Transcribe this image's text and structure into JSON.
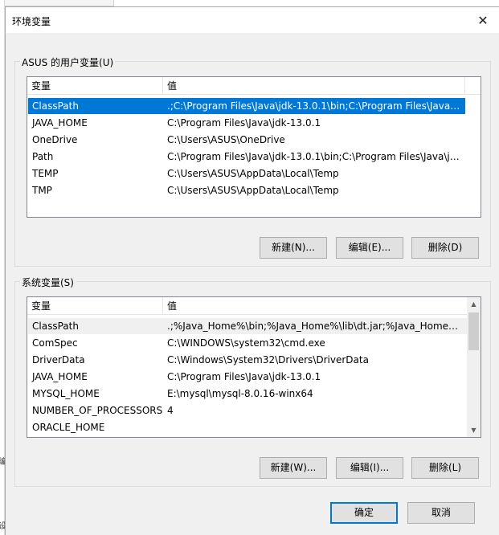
{
  "window": {
    "title": "环境变量"
  },
  "user_vars": {
    "group_label": "ASUS 的用户变量(U)",
    "col_name": "变量",
    "col_value": "值",
    "rows": [
      {
        "name": "ClassPath",
        "value": ".;C:\\Program Files\\Java\\jdk-13.0.1\\bin;C:\\Program Files\\Java\\j...",
        "selected": true
      },
      {
        "name": "JAVA_HOME",
        "value": "C:\\Program Files\\Java\\jdk-13.0.1"
      },
      {
        "name": "OneDrive",
        "value": "C:\\Users\\ASUS\\OneDrive"
      },
      {
        "name": "Path",
        "value": "C:\\Program Files\\Java\\jdk-13.0.1\\bin;C:\\Program Files\\Java\\jd..."
      },
      {
        "name": "TEMP",
        "value": "C:\\Users\\ASUS\\AppData\\Local\\Temp"
      },
      {
        "name": "TMP",
        "value": "C:\\Users\\ASUS\\AppData\\Local\\Temp"
      }
    ],
    "buttons": {
      "new": "新建(N)...",
      "edit": "编辑(E)...",
      "delete": "删除(D)"
    }
  },
  "sys_vars": {
    "group_label": "系统变量(S)",
    "col_name": "变量",
    "col_value": "值",
    "rows": [
      {
        "name": "ClassPath",
        "value": ".;%Java_Home%\\bin;%Java_Home%\\lib\\dt.jar;%Java_Home%\\...",
        "hot": true
      },
      {
        "name": "ComSpec",
        "value": "C:\\WINDOWS\\system32\\cmd.exe"
      },
      {
        "name": "DriverData",
        "value": "C:\\Windows\\System32\\Drivers\\DriverData"
      },
      {
        "name": "JAVA_HOME",
        "value": "C:\\Program Files\\Java\\jdk-13.0.1"
      },
      {
        "name": "MYSQL_HOME",
        "value": "E:\\mysql\\mysql-8.0.16-winx64"
      },
      {
        "name": "NUMBER_OF_PROCESSORS",
        "value": "4"
      },
      {
        "name": "ORACLE_HOME",
        "value": ""
      }
    ],
    "buttons": {
      "new": "新建(W)...",
      "edit": "编辑(I)...",
      "delete": "删除(L)"
    }
  },
  "footer": {
    "ok": "确定",
    "cancel": "取消"
  },
  "icons": {
    "close": "close-icon",
    "scroll_up": "chevron-up-icon",
    "scroll_down": "chevron-down-icon"
  },
  "colors": {
    "selection": "#0078d7",
    "dialog_bg": "#f0f0f0"
  }
}
